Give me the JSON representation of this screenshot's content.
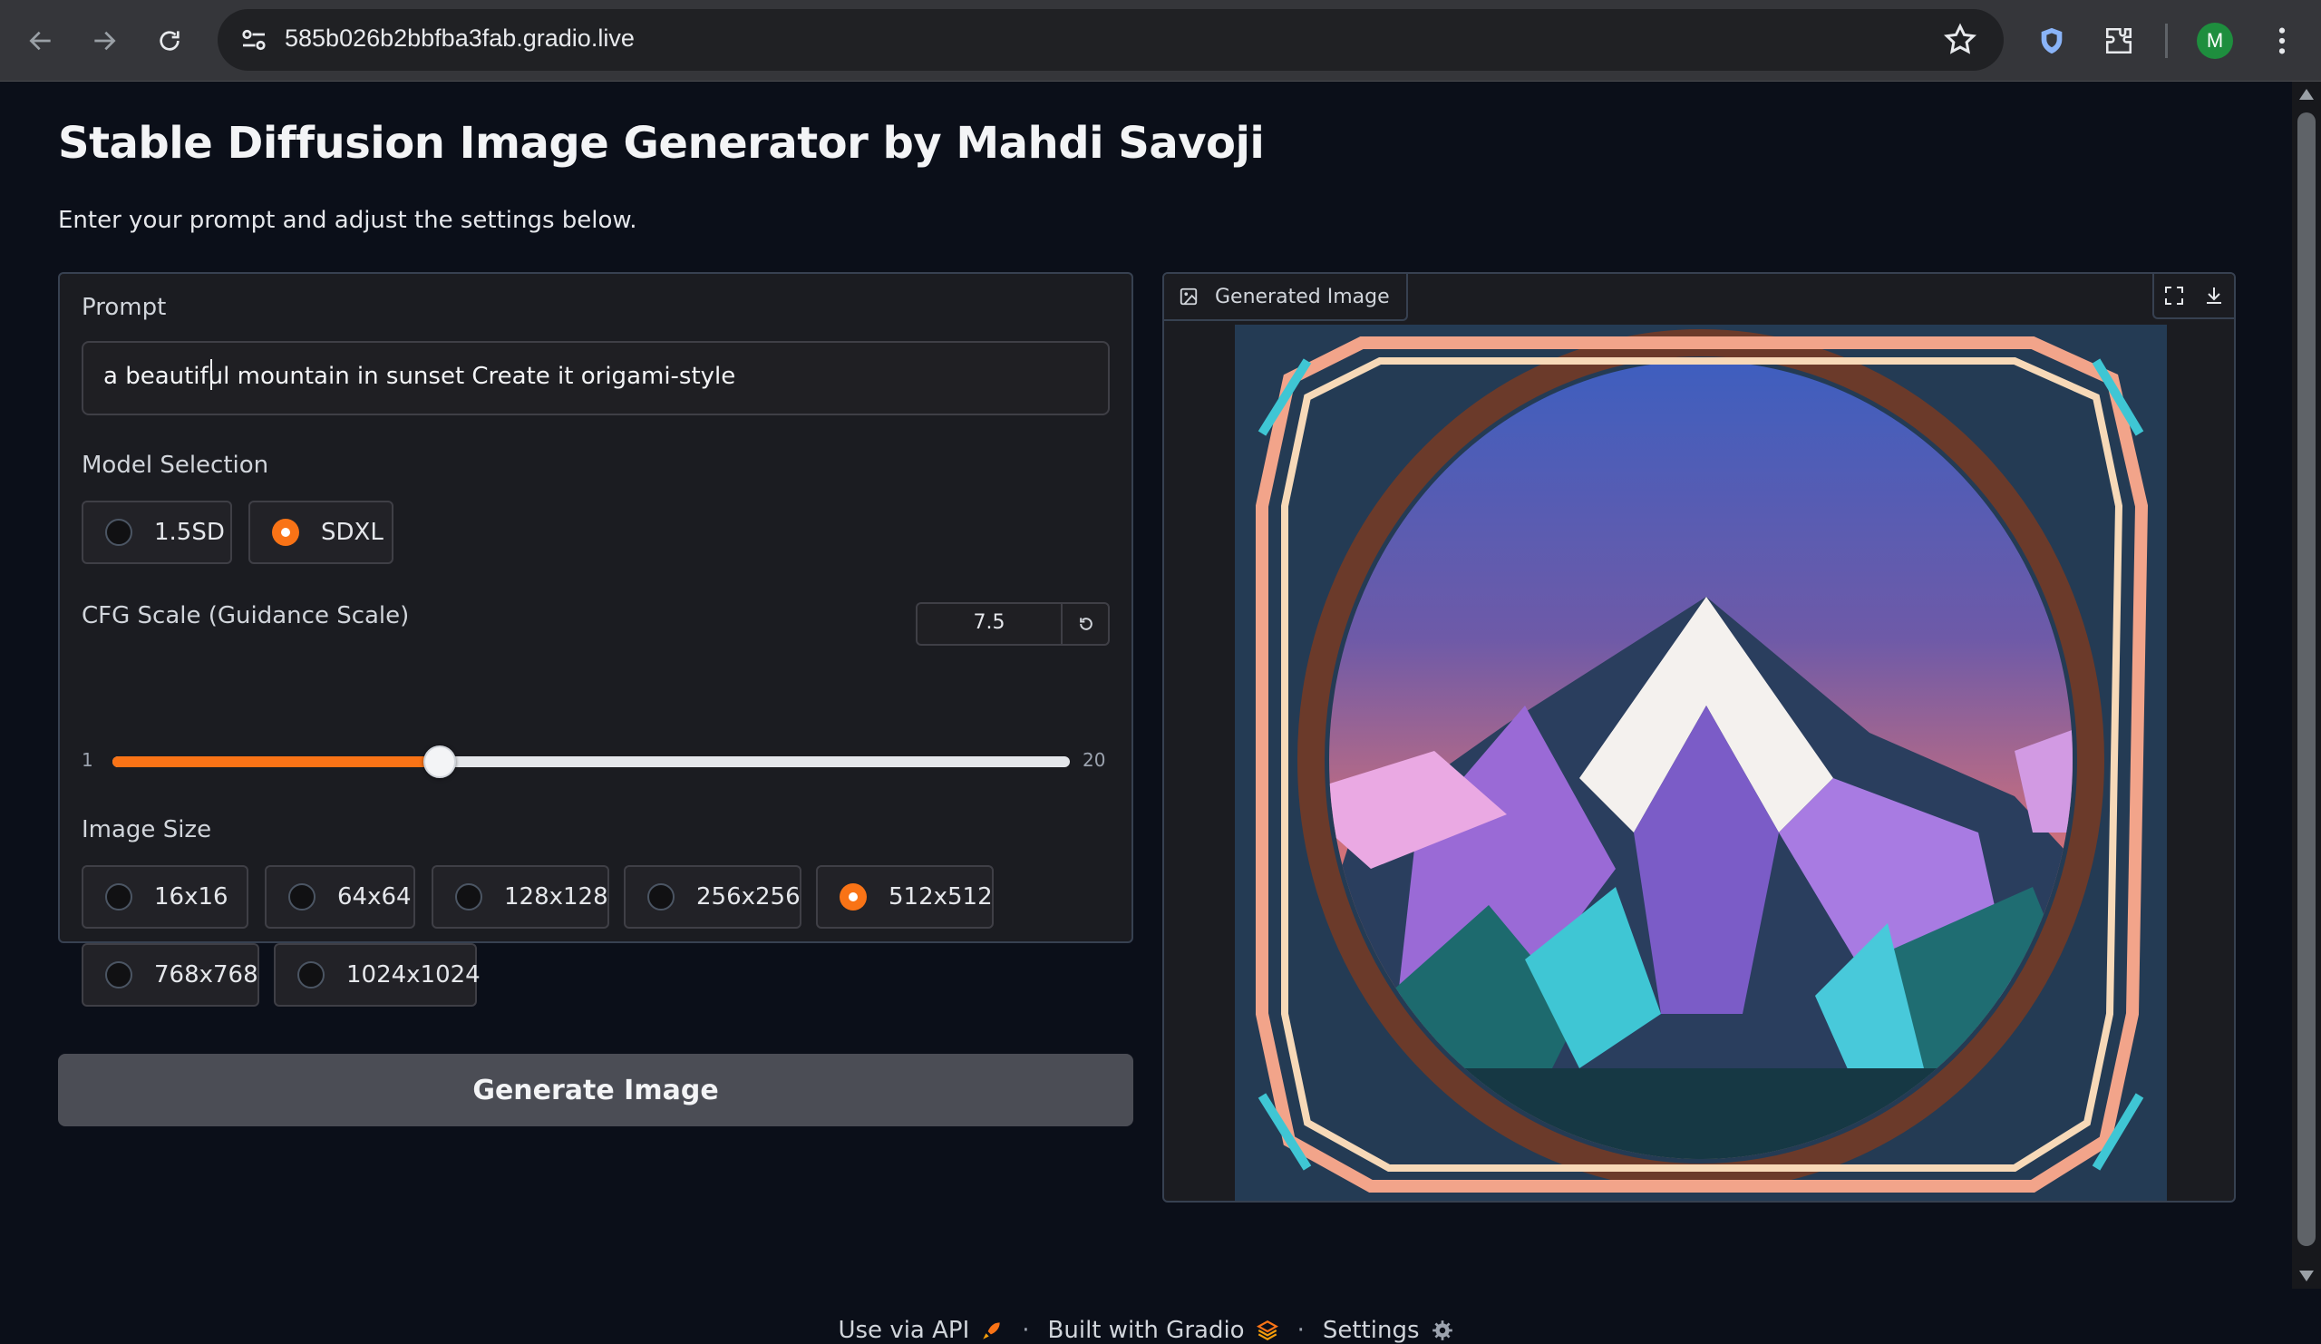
{
  "browser": {
    "url": "585b026b2bbfba3fab.gradio.live",
    "avatar_letter": "M"
  },
  "header": {
    "title": "Stable Diffusion Image Generator by Mahdi Savoji",
    "subtitle": "Enter your prompt and adjust the settings below."
  },
  "prompt": {
    "label": "Prompt",
    "value": "a beautiful mountain in sunset Create it origami-style"
  },
  "model": {
    "label": "Model Selection",
    "options": [
      "1.5SD",
      "SDXL"
    ],
    "selected": "SDXL"
  },
  "cfg": {
    "label": "CFG Scale (Guidance Scale)",
    "value": "7.5",
    "min": "1",
    "max": "20"
  },
  "size": {
    "label": "Image Size",
    "options": [
      "16x16",
      "64x64",
      "128x128",
      "256x256",
      "512x512",
      "768x768",
      "1024x1024"
    ],
    "selected": "512x512"
  },
  "generate_label": "Generate Image",
  "output": {
    "label": "Generated Image"
  },
  "footer": {
    "api": "Use via API",
    "built": "Built with Gradio",
    "settings": "Settings"
  },
  "colors": {
    "accent": "#f97316",
    "background": "#0b0f19"
  }
}
